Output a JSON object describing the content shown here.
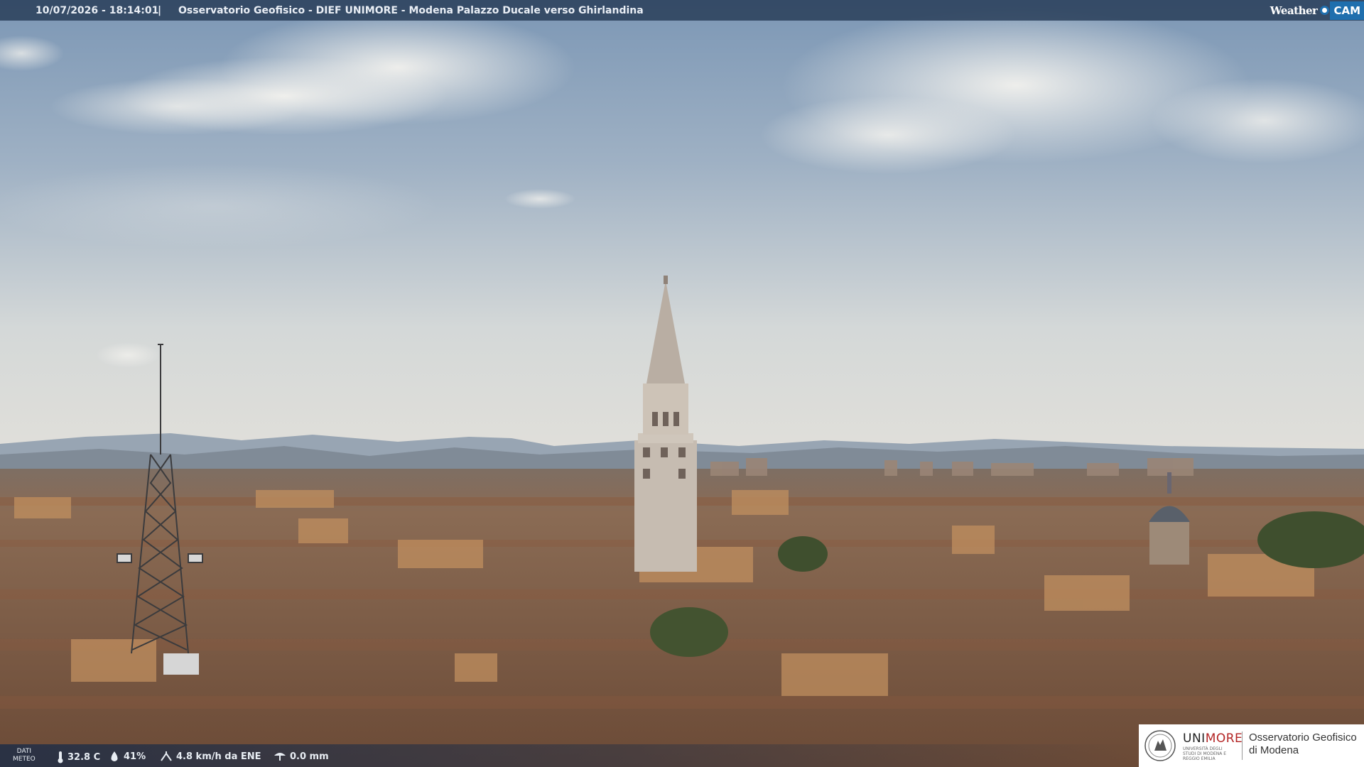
{
  "header": {
    "timestamp": "10/07/2026 - 18:14:01",
    "separator": "|",
    "title": "Osservatorio Geofisico - DIEF UNIMORE - Modena Palazzo Ducale verso Ghirlandina",
    "brand_part1": "Weather",
    "brand_part2": "CAM"
  },
  "weather": {
    "label_line1": "DATI",
    "label_line2": "METEO",
    "temperature": "32.8 C",
    "humidity": "41%",
    "wind": "4.8 km/h da ENE",
    "rain": "0.0 mm",
    "icons": [
      "thermometer-icon",
      "humidity-drop-icon",
      "wind-icon",
      "rain-gauge-icon"
    ]
  },
  "logo": {
    "name_part1": "UNI",
    "name_part2": "MORE",
    "subtitle": "UNIVERSITÀ DEGLI STUDI DI MODENA E REGGIO EMILIA",
    "observatory_line1": "Osservatorio Geofisico",
    "observatory_line2": "di Modena"
  },
  "colors": {
    "sky_top": "#7f99b6",
    "sky_horizon": "#dfe1df",
    "roof": "#7a5a44",
    "tower": "#c4b9ad",
    "unimore_red": "#b32424",
    "weathercam_blue": "#1f6fae"
  }
}
